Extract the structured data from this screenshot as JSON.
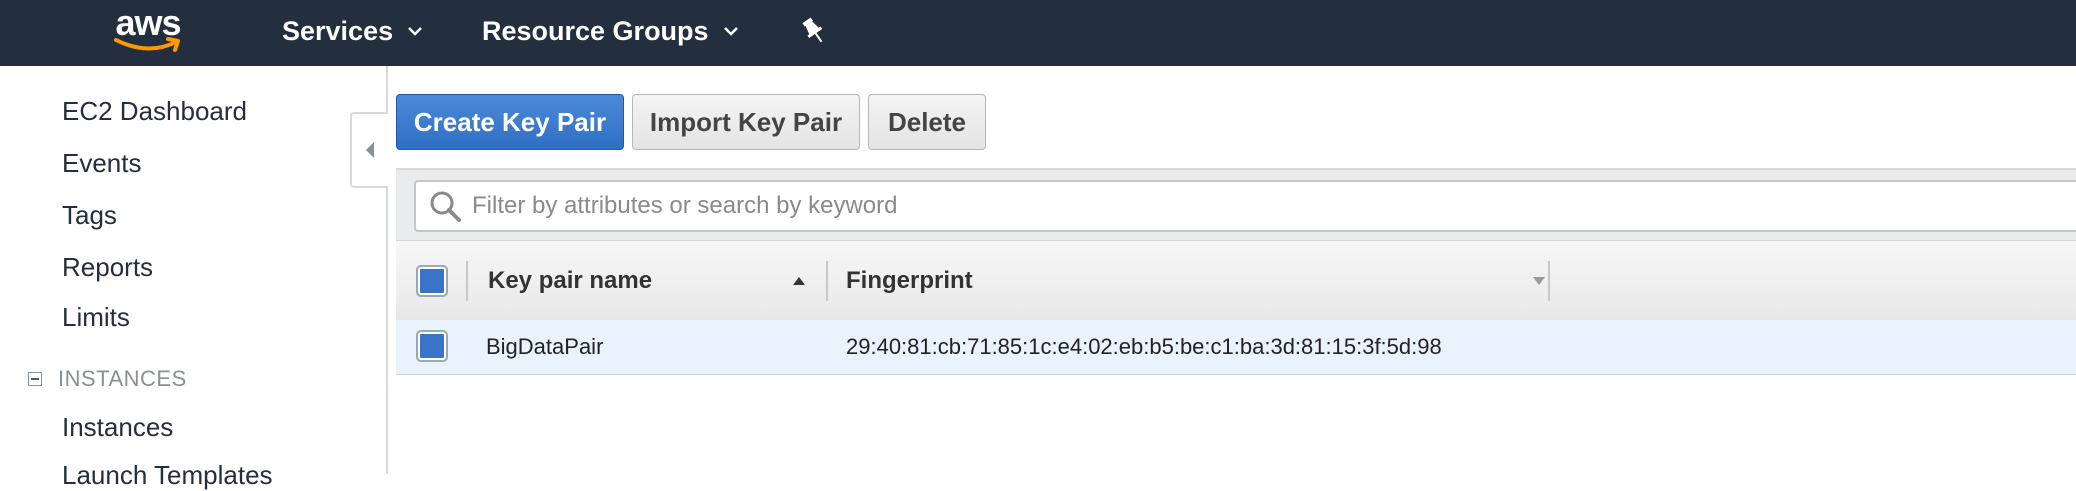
{
  "nav": {
    "logo_text": "aws",
    "services_label": "Services",
    "resource_groups_label": "Resource Groups"
  },
  "sidebar": {
    "items": [
      {
        "label": "EC2 Dashboard"
      },
      {
        "label": "Events"
      },
      {
        "label": "Tags"
      },
      {
        "label": "Reports"
      },
      {
        "label": "Limits"
      }
    ],
    "section_instances": {
      "title": "INSTANCES",
      "items": [
        {
          "label": "Instances"
        },
        {
          "label": "Launch Templates"
        }
      ]
    }
  },
  "toolbar": {
    "create_label": "Create Key Pair",
    "import_label": "Import Key Pair",
    "delete_label": "Delete"
  },
  "filter": {
    "placeholder": "Filter by attributes or search by keyword"
  },
  "table": {
    "columns": [
      "Key pair name",
      "Fingerprint"
    ],
    "rows": [
      {
        "name": "BigDataPair",
        "fingerprint": "29:40:81:cb:71:85:1c:e4:02:eb:b5:be:c1:ba:3d:81:15:3f:5d:98"
      }
    ]
  },
  "colors": {
    "nav_bg": "#232f3e",
    "primary_button": "#3a7bd5",
    "selected_row": "#eaf2fd"
  }
}
